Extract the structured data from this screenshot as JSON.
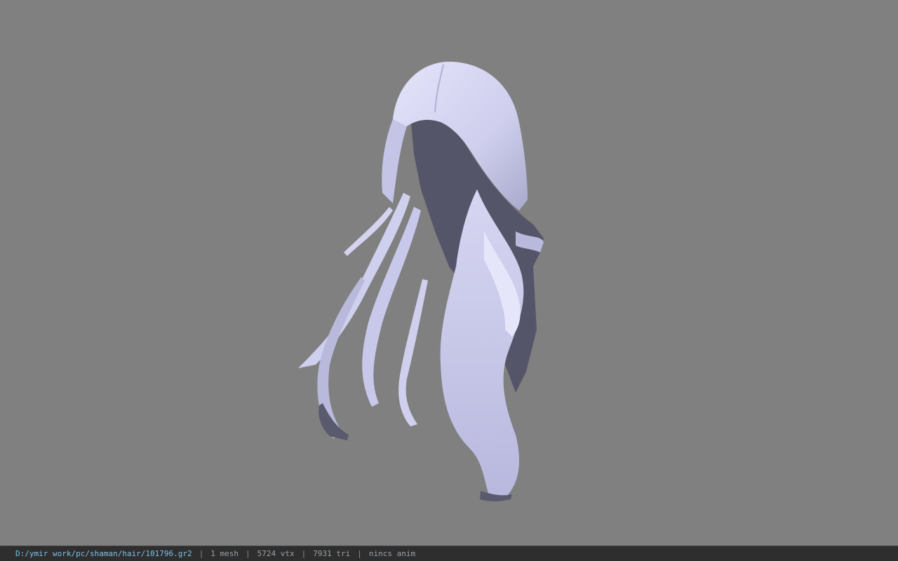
{
  "viewer": {
    "background_color": "#808080",
    "mesh_color": "#d8d8f4",
    "mesh_shadow_color": "#4a4a5a",
    "model": "hair-mesh"
  },
  "statusbar": {
    "file_path": "D:/ymir work/pc/shaman/hair/101796.gr2",
    "mesh_count": "1 mesh",
    "vertex_count": "5724 vtx",
    "triangle_count": "7931 tri",
    "anim_status": "nincs anim",
    "separator": "|"
  }
}
